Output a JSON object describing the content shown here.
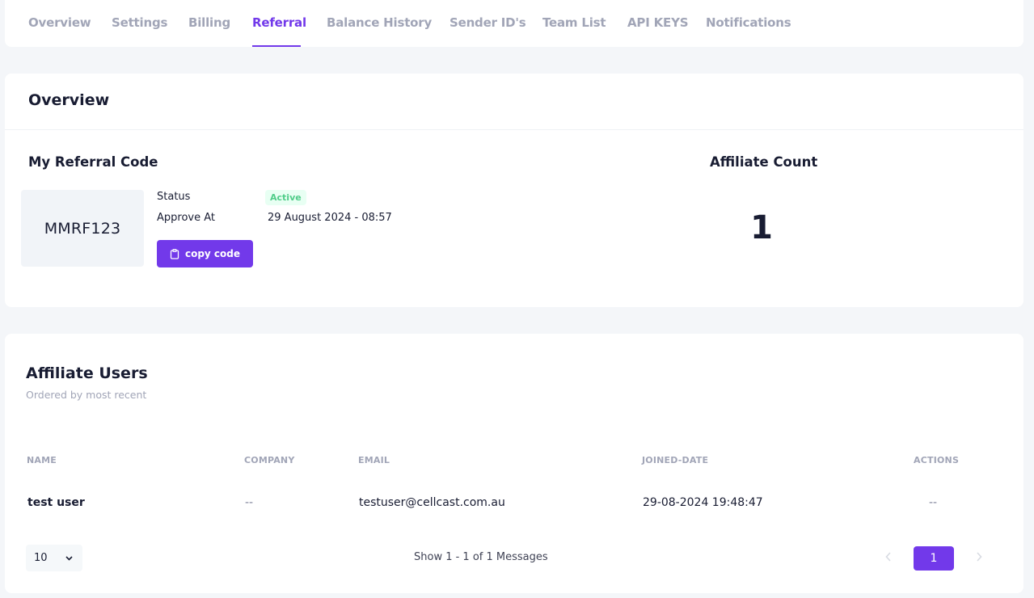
{
  "tabs": [
    {
      "label": "Overview"
    },
    {
      "label": "Settings"
    },
    {
      "label": "Billing"
    },
    {
      "label": "Referral",
      "active": true
    },
    {
      "label": "Balance History"
    },
    {
      "label": "Sender ID's"
    },
    {
      "label": "Team List"
    },
    {
      "label": "API KEYS"
    },
    {
      "label": "Notifications"
    }
  ],
  "overview": {
    "title": "Overview",
    "referral": {
      "heading": "My Referral Code",
      "code": "MMRF123",
      "status_label": "Status",
      "status_value": "Active",
      "approve_label": "Approve At",
      "approve_value": "29 August 2024 - 08:57",
      "copy_button": "copy code",
      "copy_icon": "clipboard-icon"
    },
    "affiliate": {
      "heading": "Affiliate Count",
      "count": "1"
    }
  },
  "affiliate_users": {
    "title": "Affiliate Users",
    "subtitle": "Ordered by most recent",
    "columns": [
      "NAME",
      "COMPANY",
      "EMAIL",
      "JOINED-DATE",
      "ACTIONS"
    ],
    "rows": [
      {
        "name": "test user",
        "company": "--",
        "email": "testuser@cellcast.com.au",
        "joined": "29-08-2024 19:48:47",
        "actions": "--"
      }
    ],
    "page_size": "10",
    "show_info": "Show 1 - 1 of 1 Messages",
    "current_page": "1",
    "prev_icon": "chevron-left-icon",
    "next_icon": "chevron-right-icon"
  },
  "colors": {
    "accent": "#7239ea",
    "success": "#50cd89",
    "success_bg": "#e8fff3",
    "muted": "#a1a5b7",
    "background": "#f4f6f9"
  }
}
